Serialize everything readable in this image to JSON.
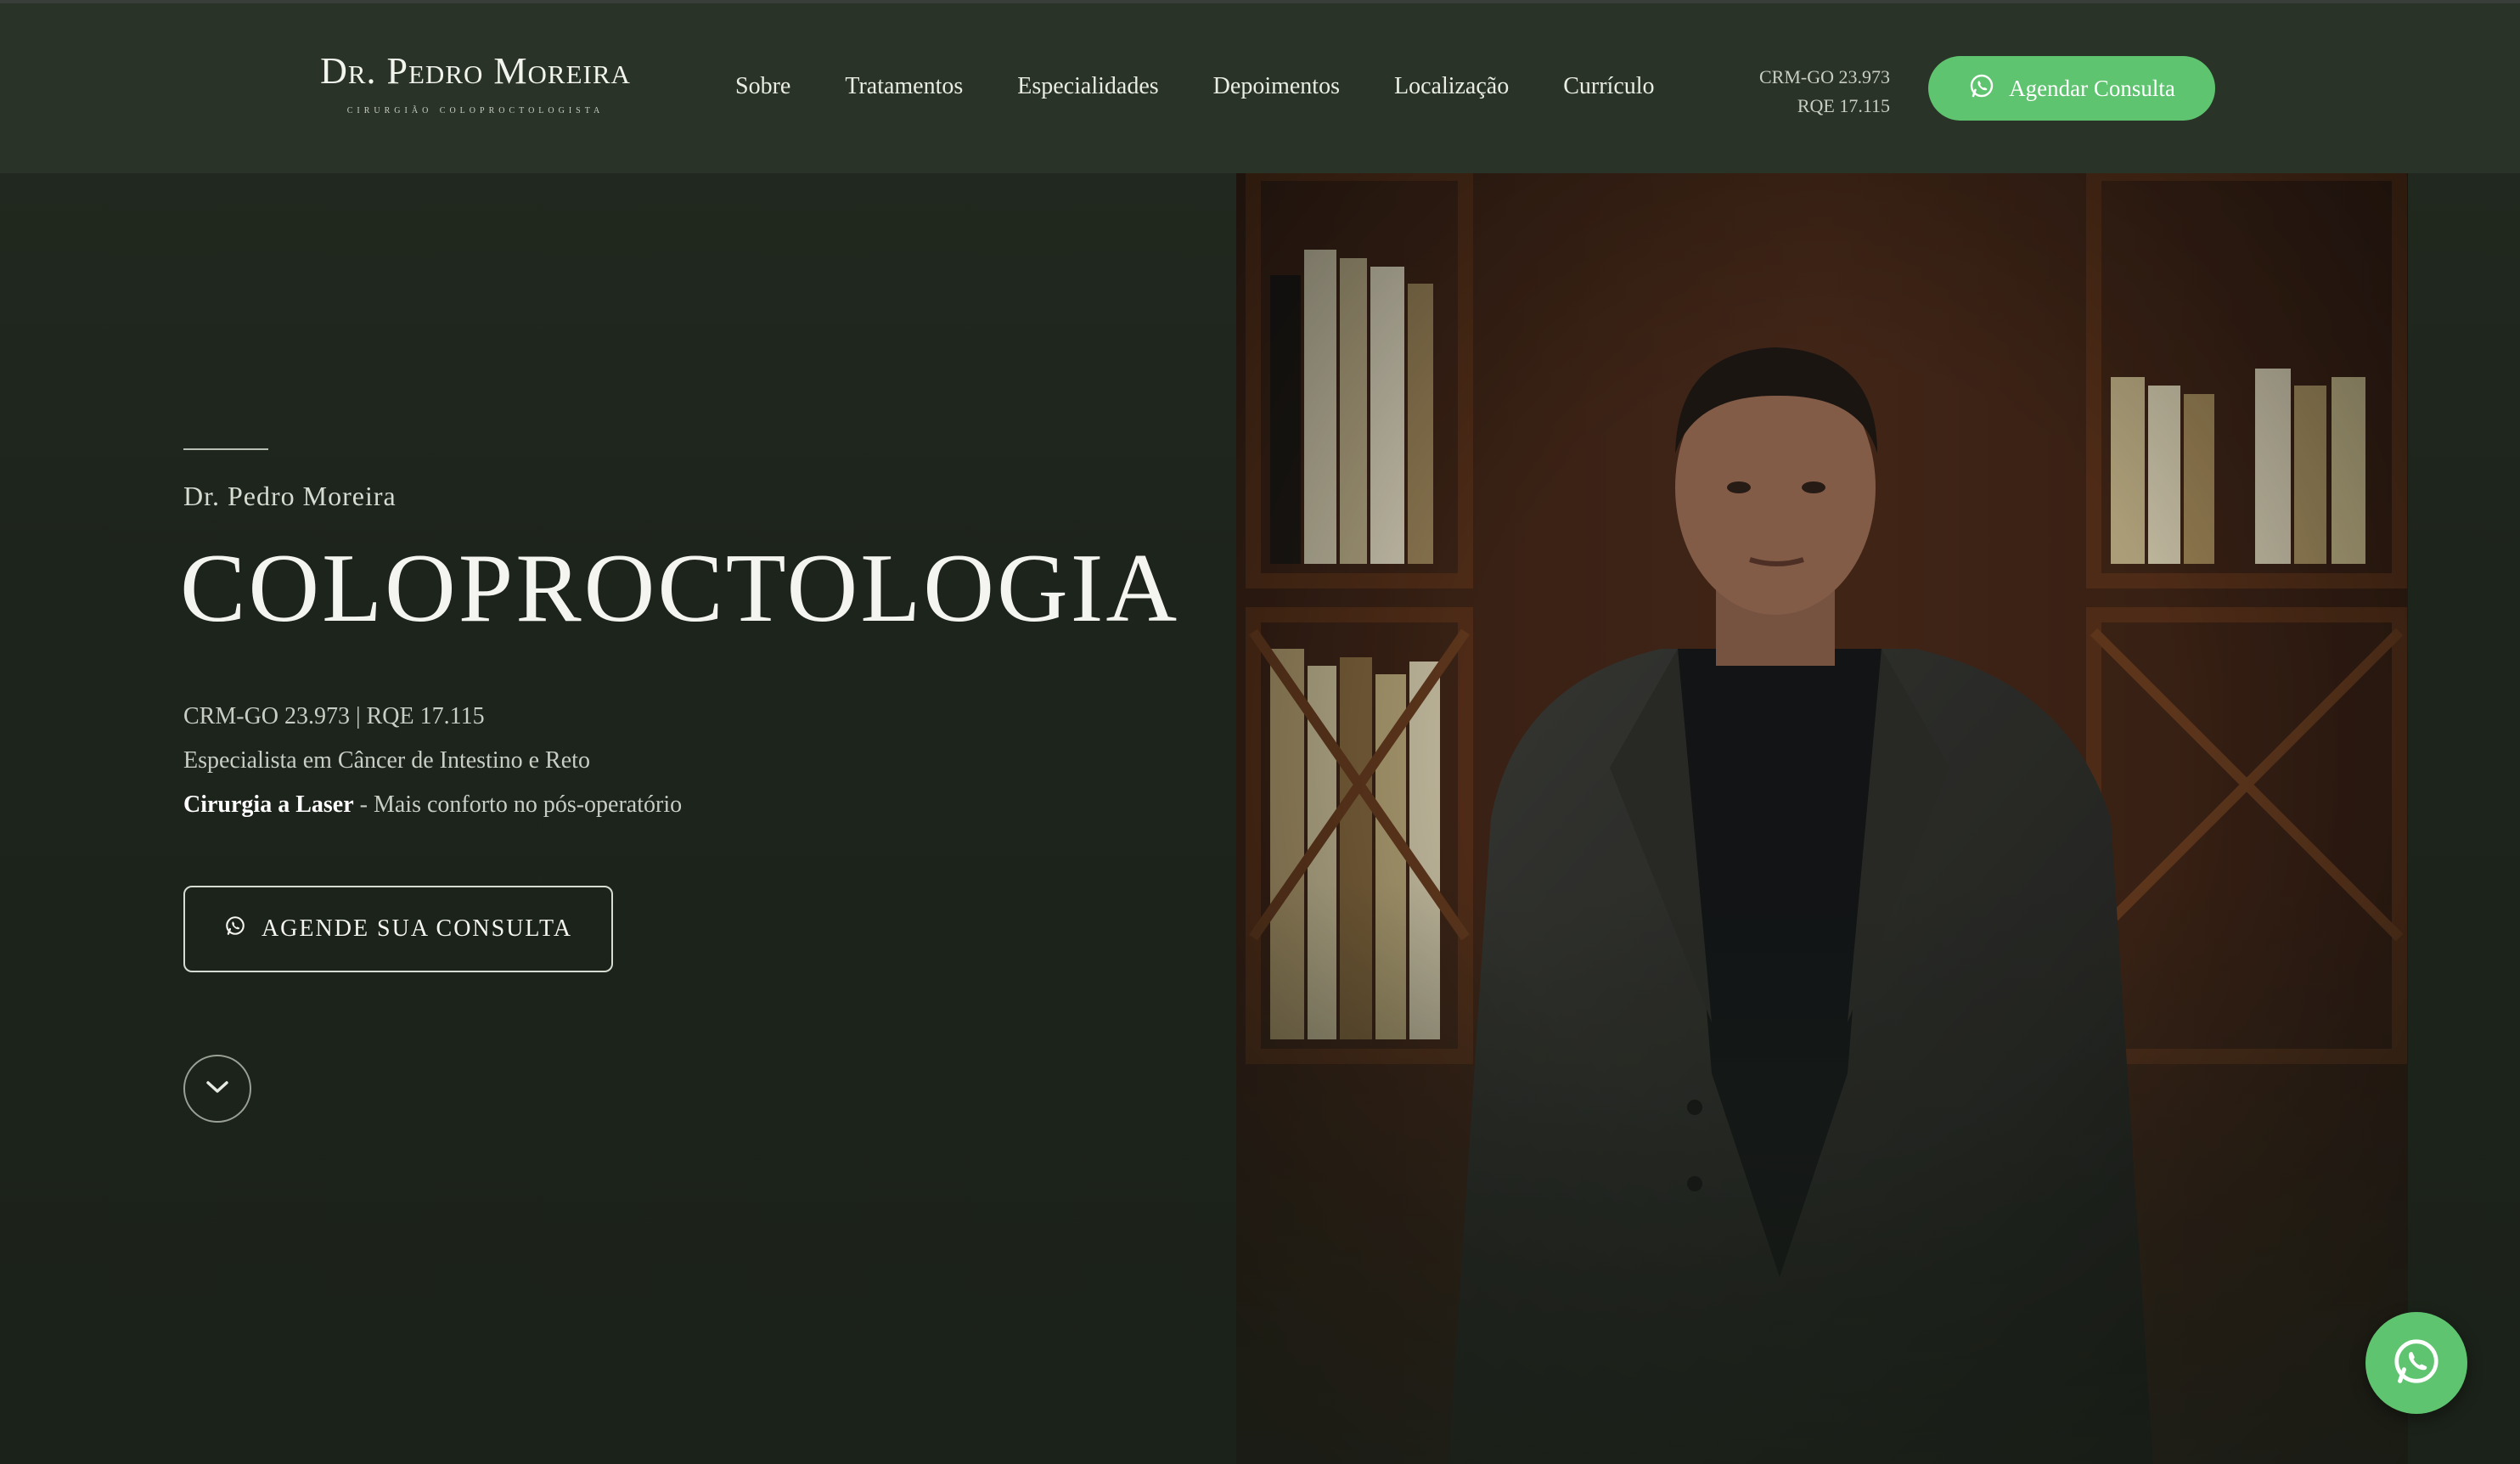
{
  "brand": {
    "name": "Dr. Pedro Moreira",
    "subtitle": "Cirurgião Coloproctologista"
  },
  "nav": {
    "items": [
      {
        "label": "Sobre"
      },
      {
        "label": "Tratamentos"
      },
      {
        "label": "Especialidades"
      },
      {
        "label": "Depoimentos"
      },
      {
        "label": "Localização"
      },
      {
        "label": "Currículo"
      }
    ]
  },
  "header": {
    "crm": "CRM-GO 23.973",
    "rqe": "RQE 17.115",
    "cta_label": "Agendar Consulta"
  },
  "hero": {
    "eyebrow": "Dr. Pedro Moreira",
    "title": "COLOPROCTOLOGIA",
    "registration": "CRM-GO 23.973 | RQE 17.115",
    "specialty": "Especialista em Câncer de Intestino e Reto",
    "laser_bold": "Cirurgia a Laser",
    "laser_rest": " - Mais conforto no pós-operatório",
    "cta_label": "AGENDE SUA CONSULTA"
  },
  "icons": {
    "whatsapp": "whatsapp-icon",
    "scroll": "chevron-down-icon"
  },
  "colors": {
    "accent_green": "#5fc46f",
    "background": "#1d241c",
    "header_bg": "#2a3327"
  }
}
